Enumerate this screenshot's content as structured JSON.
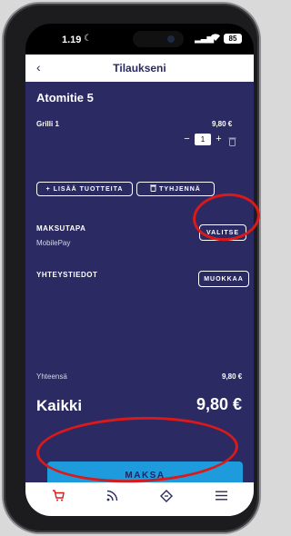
{
  "status_bar": {
    "time": "1.19",
    "battery": "85"
  },
  "header": {
    "title": "Tilaukseni",
    "back_icon": "chevron-left-icon"
  },
  "order": {
    "address": "Atomitie 5",
    "items": [
      {
        "name": "Grilli 1",
        "price": "9,80 €",
        "quantity": "1"
      }
    ],
    "add_products_label": "LISÄÄ TUOTTEITA",
    "clear_label": "TYHJENNÄ"
  },
  "payment": {
    "label": "MAKSUTAPA",
    "value": "MobilePay",
    "choose_label": "VALITSE"
  },
  "contact": {
    "label": "YHTEYSTIEDOT",
    "edit_label": "MUOKKAA"
  },
  "totals": {
    "subtotal_label": "Yhteensä",
    "subtotal_value": "9,80 €",
    "total_label": "Kaikki",
    "total_value": "9,80 €"
  },
  "pay_button": {
    "label": "MAKSA"
  },
  "tabbar": {
    "items": [
      "cart-icon",
      "rss-icon",
      "tag-icon",
      "menu-icon"
    ]
  },
  "colors": {
    "background": "#2b2a63",
    "accent": "#1e9bdc",
    "annotation": "#dc1919"
  }
}
